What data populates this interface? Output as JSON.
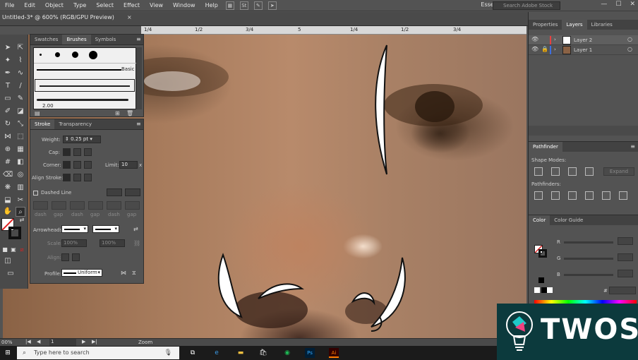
{
  "menubar": {
    "items": [
      "File",
      "Edit",
      "Object",
      "Type",
      "Select",
      "Effect",
      "View",
      "Window",
      "Help"
    ],
    "workspace": "Essentials",
    "search_placeholder": "Search Adobe Stock"
  },
  "document": {
    "tab_title": "Untitled-3* @ 600% (RGB/GPU Preview)",
    "close_glyph": "×"
  },
  "ruler": {
    "ticks": [
      "1/4",
      "1/2",
      "3/4",
      "5",
      "1/4",
      "1/2",
      "3/4"
    ]
  },
  "brushes_panel": {
    "tabs": [
      "Swatches",
      "Brushes",
      "Symbols"
    ],
    "active_tab": "Brushes",
    "basic_label": "Basic",
    "stroke_size": "2.00"
  },
  "stroke_panel": {
    "tabs": [
      "Stroke",
      "Transparency"
    ],
    "weight_label": "Weight:",
    "weight_value": "0.25 pt",
    "cap_label": "Cap:",
    "corner_label": "Corner:",
    "limit_label": "Limit:",
    "limit_value": "10",
    "limit_unit": "x",
    "align_stroke_label": "Align Stroke:",
    "dashed_line_label": "Dashed Line",
    "dash_labels": [
      "dash",
      "gap",
      "dash",
      "gap",
      "dash",
      "gap"
    ],
    "arrowheads_label": "Arrowheads:",
    "scale_label": "Scale:",
    "scale_value_1": "100%",
    "scale_value_2": "100%",
    "align_label": "Align:",
    "profile_label": "Profile:",
    "profile_value": "Uniform"
  },
  "right_panels": {
    "top_tabs": [
      "Properties",
      "Layers",
      "Libraries"
    ],
    "active_tab": "Layers",
    "layers": [
      {
        "name": "Layer 2",
        "color": "#e84040"
      },
      {
        "name": "Layer 1",
        "color": "#3d6fe0"
      }
    ],
    "pathfinder": {
      "title": "Pathfinder",
      "shape_modes_label": "Shape Modes:",
      "pathfinders_label": "Pathfinders:",
      "expand_label": "Expand"
    },
    "color": {
      "tabs": [
        "Color",
        "Color Guide"
      ],
      "channels": [
        "R",
        "G",
        "B"
      ],
      "hex_prefix": "#"
    }
  },
  "statusbar": {
    "zoom": "00%",
    "artboard": "1",
    "tool": "Zoom"
  },
  "taskbar": {
    "search_placeholder": "Type here to search",
    "apps": [
      "task-view",
      "edge",
      "file-explorer",
      "store",
      "spotify",
      "photoshop",
      "illustrator"
    ]
  },
  "watermark": {
    "text": "TWOS"
  },
  "colors": {
    "accent": "#ff7c00",
    "layer2": "#e84040",
    "layer1": "#3d6fe0",
    "watermark_bg": "#0c3a3d"
  }
}
